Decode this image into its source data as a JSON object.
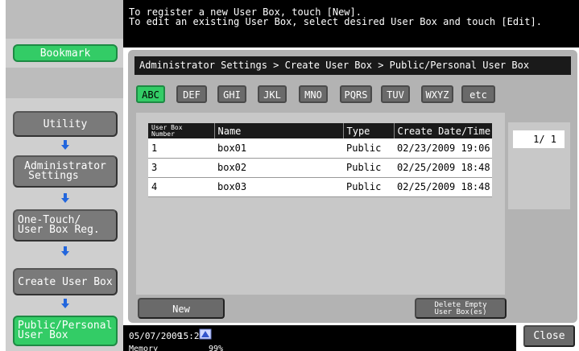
{
  "message": {
    "line1": "To register a new User Box, touch [New].",
    "line2": "To edit an existing User Box, select desired User Box and touch [Edit]."
  },
  "sidebar": {
    "bookmark": "Bookmark",
    "utility": "Utility",
    "admin_line1": "Administrator",
    "admin_line2": "Settings",
    "onetouch_line1": "One-Touch/",
    "onetouch_line2": "User Box Reg.",
    "create": "Create User Box",
    "public_line1": "Public/Personal",
    "public_line2": "User Box"
  },
  "breadcrumb": "Administrator Settings > Create User Box > Public/Personal User Box",
  "tabs": [
    "ABC",
    "DEF",
    "GHI",
    "JKL",
    "MNO",
    "PQRS",
    "TUV",
    "WXYZ",
    "etc"
  ],
  "active_tab": "ABC",
  "table": {
    "headers": {
      "number_line1": "User Box",
      "number_line2": "Number",
      "name": "Name",
      "type": "Type",
      "date": "Create Date/Time"
    },
    "rows": [
      {
        "number": "1",
        "name": "box01",
        "type": "Public",
        "date": "02/23/2009 19:06"
      },
      {
        "number": "3",
        "name": "box02",
        "type": "Public",
        "date": "02/25/2009 18:48"
      },
      {
        "number": "4",
        "name": "box03",
        "type": "Public",
        "date": "02/25/2009 18:48"
      }
    ]
  },
  "pager": "1/  1",
  "buttons": {
    "new": "New",
    "delete_line1": "Delete Empty",
    "delete_line2": "User Box(es)",
    "close": "Close"
  },
  "footer": {
    "date": "05/07/2009",
    "time": "15:26",
    "memory_label": "Memory",
    "memory_value": "99%"
  },
  "colors": {
    "accent_green": "#33cc66",
    "arrow_blue": "#2266dd"
  },
  "icons": {
    "arrow": "arrow-down-icon",
    "network": "network-icon"
  }
}
